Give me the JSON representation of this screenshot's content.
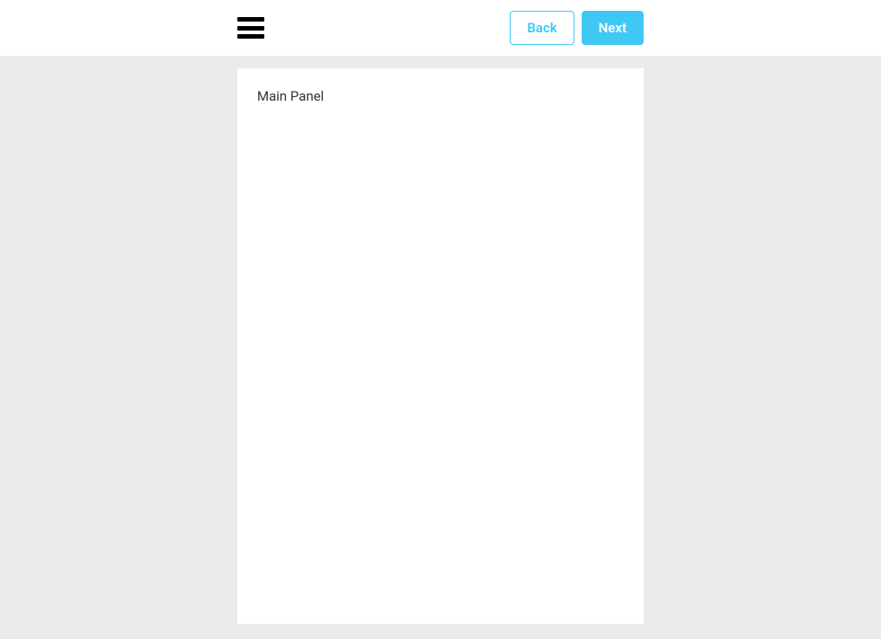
{
  "header": {
    "back_label": "Back",
    "next_label": "Next"
  },
  "panel": {
    "title": "Main Panel"
  }
}
